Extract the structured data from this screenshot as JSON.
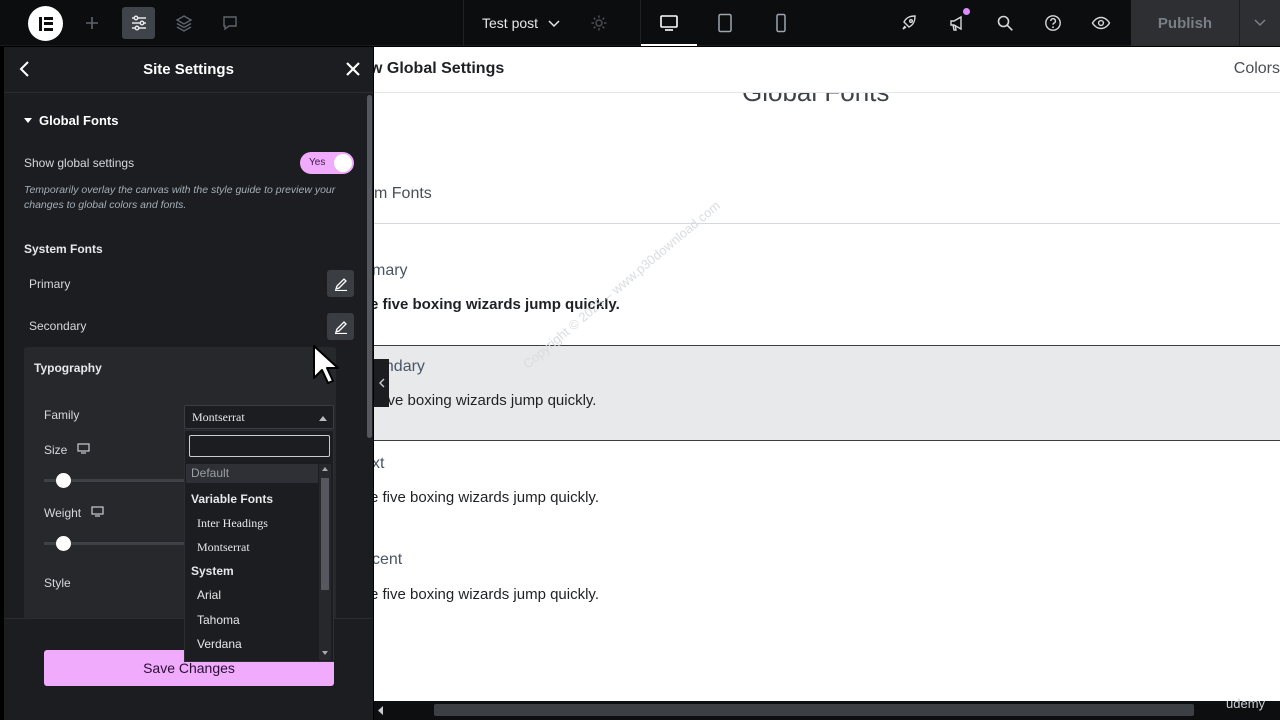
{
  "topbar": {
    "doc_title": "Test post",
    "publish_label": "Publish",
    "accent_color": "#f0abfc"
  },
  "sidebar": {
    "title": "Site Settings",
    "section_title": "Global Fonts",
    "show_global_label": "Show global settings",
    "toggle_value": "Yes",
    "description": "Temporarily overlay the canvas with the style guide to preview your changes to global colors and fonts.",
    "system_fonts_title": "System Fonts",
    "primary_label": "Primary",
    "secondary_label": "Secondary",
    "typography": {
      "title": "Typography",
      "family_label": "Family",
      "family_value": "Montserrat",
      "size_label": "Size",
      "weight_label": "Weight",
      "style_label": "Style"
    },
    "save_label": "Save Changes"
  },
  "dropdown": {
    "default_item": "Default",
    "group_variable": "Variable Fonts",
    "group_system": "System",
    "variable_items": [
      "Inter Headings",
      "Montserrat"
    ],
    "system_items": [
      "Arial",
      "Tahoma",
      "Verdana"
    ]
  },
  "canvas": {
    "header_title": "w Global Settings",
    "header_right": "Colors",
    "big_title": "Global Fonts",
    "subtitle": "m Fonts",
    "blocks": [
      {
        "name": "mary",
        "sample": "e five boxing wizards jump quickly."
      },
      {
        "name": "ondary",
        "sample": "five boxing wizards jump quickly."
      },
      {
        "name": "xt",
        "sample": "e five boxing wizards jump quickly."
      },
      {
        "name": "cent",
        "sample": "e five boxing wizards jump quickly."
      }
    ]
  },
  "watermark": "Copyright © 2025 – www.p30download.com",
  "udemy_label": "udemy"
}
